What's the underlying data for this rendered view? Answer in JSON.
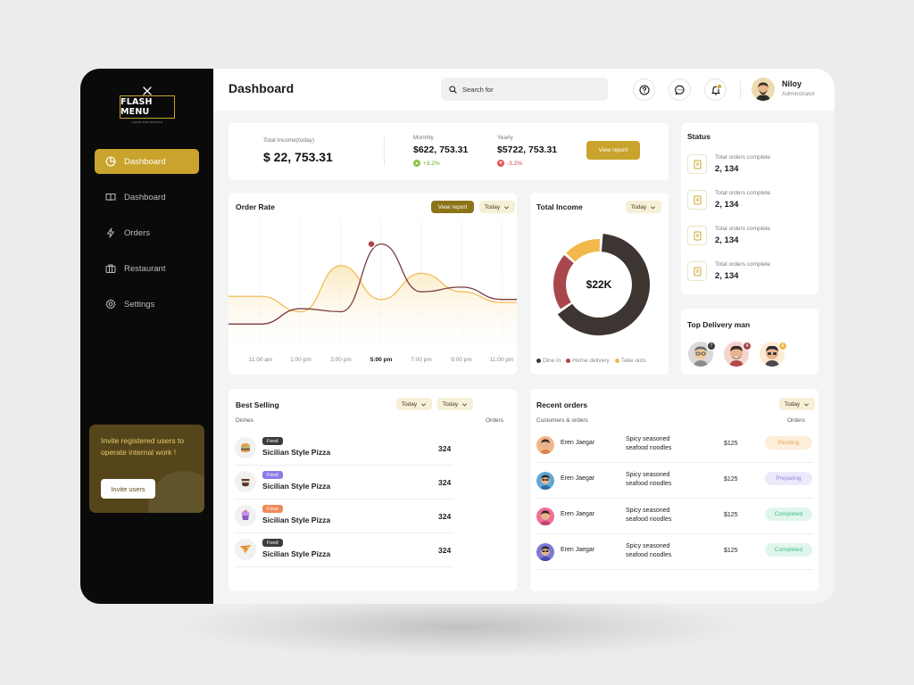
{
  "brand": {
    "logo_text": "FLASH MENU",
    "tagline": "LOGIN FOR DETAILS"
  },
  "sidebar": {
    "items": [
      {
        "label": "Dashboard",
        "icon": "pie-chart-icon",
        "active": true
      },
      {
        "label": "Dashboard",
        "icon": "book-icon",
        "active": false
      },
      {
        "label": "Orders",
        "icon": "lightning-icon",
        "active": false
      },
      {
        "label": "Restaurant",
        "icon": "briefcase-icon",
        "active": false
      },
      {
        "label": "Settings",
        "icon": "gear-icon",
        "active": false
      }
    ],
    "invite": {
      "text": "Invite registered users to operate internal work !",
      "button": "Invite users"
    }
  },
  "header": {
    "title": "Dashboard",
    "search_placeholder": "Search for",
    "user": {
      "name": "Niloy",
      "role": "Adminstrator"
    }
  },
  "summary": {
    "total_income_label": "Total Income(today)",
    "total_income_value": "$ 22, 753.31",
    "monthly_label": "Monthly",
    "monthly_value": "$622, 753.31",
    "monthly_change": "+3.2%",
    "yearly_label": "Yearly",
    "yearly_value": "$5722, 753.31",
    "yearly_change": "-3.2%",
    "view_report": "View report"
  },
  "status": {
    "title": "Status",
    "items": [
      {
        "label": "Total orders complete",
        "value": "2, 134"
      },
      {
        "label": "Total orders complete",
        "value": "2, 134"
      },
      {
        "label": "Total orders complete",
        "value": "2, 134"
      },
      {
        "label": "Total orders complete",
        "value": "2, 134"
      }
    ]
  },
  "order_rate": {
    "title": "Order Rate",
    "view_report": "View report",
    "period": "Today",
    "highlight": "5:00 pm"
  },
  "total_income": {
    "title": "Total Income",
    "period": "Today",
    "center_value": "$22K",
    "legend": [
      {
        "label": "Dine in",
        "color": "#3d3531"
      },
      {
        "label": "Home delivery",
        "color": "#a8484d"
      },
      {
        "label": "Take outs",
        "color": "#f2b84c"
      }
    ]
  },
  "top_delivery": {
    "title": "Top Delivery man",
    "badges": [
      "7",
      "4",
      "6"
    ]
  },
  "best_selling": {
    "title": "Best Selling",
    "filter1": "Today",
    "filter2": "Today",
    "col_dishes": "Dishes",
    "col_orders": "Orders",
    "rows": [
      {
        "tag": "Food",
        "tag_color": "#3c3c3c",
        "name": "Sicilian Style Pizza",
        "orders": "324",
        "icon": "burger-icon"
      },
      {
        "tag": "Food",
        "tag_color": "#8c7be8",
        "name": "Sicilian Style Pizza",
        "orders": "324",
        "icon": "coffee-icon"
      },
      {
        "tag": "Food",
        "tag_color": "#ef8a5a",
        "name": "Sicilian Style Pizza",
        "orders": "324",
        "icon": "cupcake-icon"
      },
      {
        "tag": "Food",
        "tag_color": "#3c3c3c",
        "name": "Sicilian Style Pizza",
        "orders": "324",
        "icon": "pizza-icon"
      }
    ]
  },
  "recent_orders": {
    "title": "Recent orders",
    "period": "Today",
    "col_left": "Customers & orders",
    "col_right": "Orders",
    "rows": [
      {
        "name": "Eren Jaegar",
        "food_line1": "Spicy seasoned",
        "food_line2": "seafood noodles",
        "price": "$125",
        "status": "Pending",
        "status_bg": "#fdeed9",
        "status_fg": "#e9a45b",
        "avatar_bg": "#f2b58a"
      },
      {
        "name": "Eren Jaegar",
        "food_line1": "Spicy seasoned",
        "food_line2": "seafood noodles",
        "price": "$125",
        "status": "Preparing",
        "status_bg": "#ece9fb",
        "status_fg": "#8d84e0",
        "avatar_bg": "#5fa8d9"
      },
      {
        "name": "Eren Jaegar",
        "food_line1": "Spicy seasoned",
        "food_line2": "seafood noodles",
        "price": "$125",
        "status": "Completed",
        "status_bg": "#e0f6ec",
        "status_fg": "#3ebd8a",
        "avatar_bg": "#ef6f97"
      },
      {
        "name": "Eren Jaegar",
        "food_line1": "Spicy seasoned",
        "food_line2": "seafood noodles",
        "price": "$125",
        "status": "Completed",
        "status_bg": "#e0f6ec",
        "status_fg": "#3ebd8a",
        "avatar_bg": "#7c79d8"
      }
    ]
  },
  "chart_data": [
    {
      "type": "area",
      "title": "Order Rate",
      "categories": [
        "11:00 am",
        "1:00 pm",
        "3:00 pm",
        "5:00 pm",
        "7:00 pm",
        "9:00 pm",
        "11:00 pm"
      ],
      "series": [
        {
          "color": "#7a3b3b",
          "values": [
            12,
            22,
            20,
            64,
            33,
            36,
            28
          ]
        },
        {
          "color": "#f2bc55",
          "values": [
            30,
            20,
            50,
            28,
            45,
            33,
            26
          ]
        }
      ],
      "highlight_category": "5:00 pm",
      "grid": true
    },
    {
      "type": "pie",
      "title": "Total Income",
      "labels": [
        "Dine in",
        "Home delivery",
        "Take outs"
      ],
      "values": [
        55,
        18,
        12
      ],
      "colors": [
        "#3d3531",
        "#a8484d",
        "#f2b84c"
      ],
      "center_label": "$22K"
    }
  ]
}
